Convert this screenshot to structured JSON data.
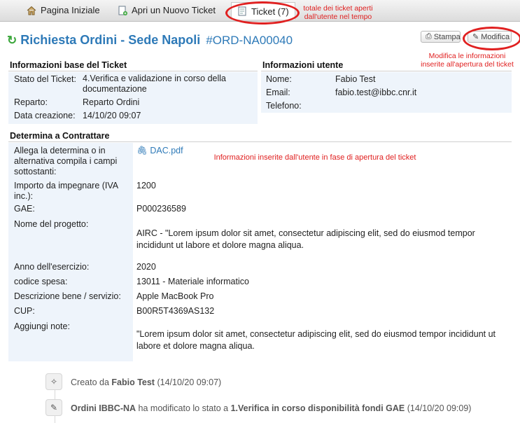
{
  "nav": {
    "home": "Pagina Iniziale",
    "new_ticket": "Apri un Nuovo Ticket",
    "tickets": "Ticket (7)"
  },
  "annotations": {
    "tickets_total": "totale dei ticket aperti dall'utente nel tempo",
    "modify": "Modifica le informazioni inserite all'apertura del ticket",
    "user_info": "Informazioni  inserite dall'utente in fase di apertura del ticket"
  },
  "ticket": {
    "title": "Richiesta Ordini - Sede Napoli",
    "code": "#ORD-NA00040",
    "print_label": "Stampa",
    "edit_label": "Modifica"
  },
  "base_info": {
    "heading": "Informazioni base del Ticket",
    "rows": [
      {
        "label": "Stato del Ticket:",
        "value": "4.Verifica e validazione in corso della documentazione"
      },
      {
        "label": "Reparto:",
        "value": "Reparto Ordini"
      },
      {
        "label": "Data creazione:",
        "value": "14/10/20 09:07"
      }
    ]
  },
  "user_info": {
    "heading": "Informazioni utente",
    "rows": [
      {
        "label": "Nome:",
        "value": "Fabio Test"
      },
      {
        "label": "Email:",
        "value": "fabio.test@ibbc.cnr.it"
      },
      {
        "label": "Telefono:",
        "value": ""
      }
    ]
  },
  "determina": {
    "heading": "Determina a Contrattare",
    "rows": [
      {
        "label": "Allega la determina o in alternativa compila i campi sottostanti:",
        "value": "DAC.pdf"
      },
      {
        "label": "Importo da impegnare (IVA inc.):",
        "value": "1200"
      },
      {
        "label": "GAE:",
        "value": "P000236589"
      },
      {
        "label": "Nome del progetto:",
        "value": "AIRC - \"Lorem ipsum dolor sit amet, consectetur adipiscing elit, sed do eiusmod tempor incididunt ut labore et dolore magna aliqua."
      },
      {
        "label": "Anno dell'esercizio:",
        "value": "2020"
      },
      {
        "label": "codice spesa:",
        "value": "13011 - Materiale informatico"
      },
      {
        "label": "Descrizione bene / servizio:",
        "value": "Apple MacBook Pro"
      },
      {
        "label": "CUP:",
        "value": "B00R5T4369AS132"
      },
      {
        "label": "Aggiungi note:",
        "value": "\"Lorem ipsum dolor sit amet, consectetur adipiscing elit, sed do eiusmod tempor incididunt ut labore et dolore magna aliqua."
      }
    ]
  },
  "timeline": [
    {
      "prefix": "Creato da",
      "actor": "Fabio Test",
      "middle": "",
      "target": "",
      "time": "(14/10/20 09:07)"
    },
    {
      "prefix": "",
      "actor": "Ordini IBBC-NA",
      "middle": "ha modificato lo stato a",
      "target": "1.Verifica in corso disponibilità fondi GAE",
      "time": "(14/10/20 09:09)"
    }
  ]
}
